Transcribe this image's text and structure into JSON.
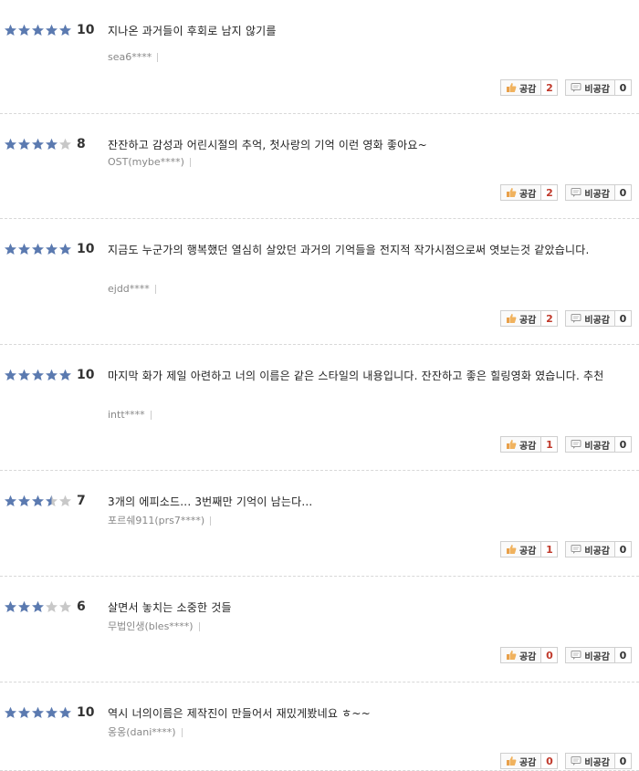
{
  "colors": {
    "star_on": "#5b7ab0",
    "star_off": "#c8c8c8",
    "positive_count": "#c0392b"
  },
  "icons": {
    "like": "thumbs-up-icon",
    "dislike": "speech-bubble-icon",
    "star": "star-icon"
  },
  "reviews": [
    {
      "stars": 5,
      "score": "10",
      "text": "지나온 과거들이 후회로 남지 않기를",
      "author": "sea6****",
      "like_label": "공감",
      "likes": "2",
      "dislike_label": "비공감",
      "dislikes": "0"
    },
    {
      "stars": 4,
      "score": "8",
      "text": "잔잔하고 감성과 어린시절의 추억, 첫사랑의 기억 이런 영화 좋아요~",
      "author": "OST(mybe****)",
      "like_label": "공감",
      "likes": "2",
      "dislike_label": "비공감",
      "dislikes": "0"
    },
    {
      "stars": 5,
      "score": "10",
      "text": "지금도 누군가의 행복했던 열심히 살았던 과거의 기억들을 전지적 작가시점으로써 엿보는것 같았습니다.",
      "author": "ejdd****",
      "like_label": "공감",
      "likes": "2",
      "dislike_label": "비공감",
      "dislikes": "0"
    },
    {
      "stars": 5,
      "score": "10",
      "text": "마지막 화가 제일 아련하고 너의 이름은 같은 스타일의 내용입니다. 잔잔하고 좋은 힐링영화 였습니다. 추천",
      "author": "intt****",
      "like_label": "공감",
      "likes": "1",
      "dislike_label": "비공감",
      "dislikes": "0"
    },
    {
      "stars": 3.5,
      "score": "7",
      "text": "3개의 에피소드... 3번째만 기억이 남는다...",
      "author": "포르쉐911(prs7****)",
      "like_label": "공감",
      "likes": "1",
      "dislike_label": "비공감",
      "dislikes": "0"
    },
    {
      "stars": 3,
      "score": "6",
      "text": "살면서 놓치는 소중한 것들",
      "author": "무법인생(bles****)",
      "like_label": "공감",
      "likes": "0",
      "dislike_label": "비공감",
      "dislikes": "0"
    },
    {
      "stars": 5,
      "score": "10",
      "text": "역시 너의이름은 제작진이 만들어서 재밌게봤네요 ㅎ~~",
      "author": "옹옹(dani****)",
      "like_label": "공감",
      "likes": "0",
      "dislike_label": "비공감",
      "dislikes": "0"
    }
  ]
}
